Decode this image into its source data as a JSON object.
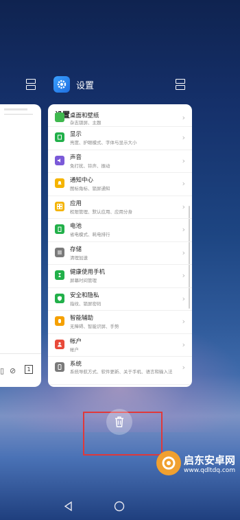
{
  "app": {
    "name": "设置"
  },
  "settings": {
    "title": "设置",
    "items": [
      {
        "title": "桌面和壁纸",
        "subtitle": "杂志锁屏、主题",
        "color": "#3fb84e"
      },
      {
        "title": "显示",
        "subtitle": "亮度、护眼模式、字体与显示大小",
        "color": "#22b04a"
      },
      {
        "title": "声音",
        "subtitle": "免打扰、铃声、振动",
        "color": "#7b5ad8"
      },
      {
        "title": "通知中心",
        "subtitle": "图标角标、锁屏通知",
        "color": "#f5b400"
      },
      {
        "title": "应用",
        "subtitle": "权限管理、默认应用、应用分身",
        "color": "#f5b400"
      },
      {
        "title": "电池",
        "subtitle": "省电模式、耗电排行",
        "color": "#22b04a"
      },
      {
        "title": "存储",
        "subtitle": "清理加速",
        "color": "#7a7a7a"
      },
      {
        "title": "健康使用手机",
        "subtitle": "屏幕时间管理",
        "color": "#22b04a"
      },
      {
        "title": "安全和隐私",
        "subtitle": "指纹、锁屏密码",
        "color": "#22b04a"
      },
      {
        "title": "智能辅助",
        "subtitle": "无障碍、智能识屏、手势",
        "color": "#f5a000"
      },
      {
        "title": "帐户",
        "subtitle": "帐户",
        "color": "#e84a3a"
      },
      {
        "title": "系统",
        "subtitle": "系统导航方式、软件更新、关于手机、语言和输入法",
        "color": "#7a7a7a"
      }
    ]
  },
  "left_card": {
    "badge": "1"
  },
  "watermark": {
    "title": "启东安卓网",
    "url": "www.qdltdq.com"
  },
  "icons": {
    "app": "gear-icon",
    "trash": "trash-icon",
    "switch": "window-switch-icon",
    "nav": [
      "back-icon",
      "home-icon"
    ]
  }
}
